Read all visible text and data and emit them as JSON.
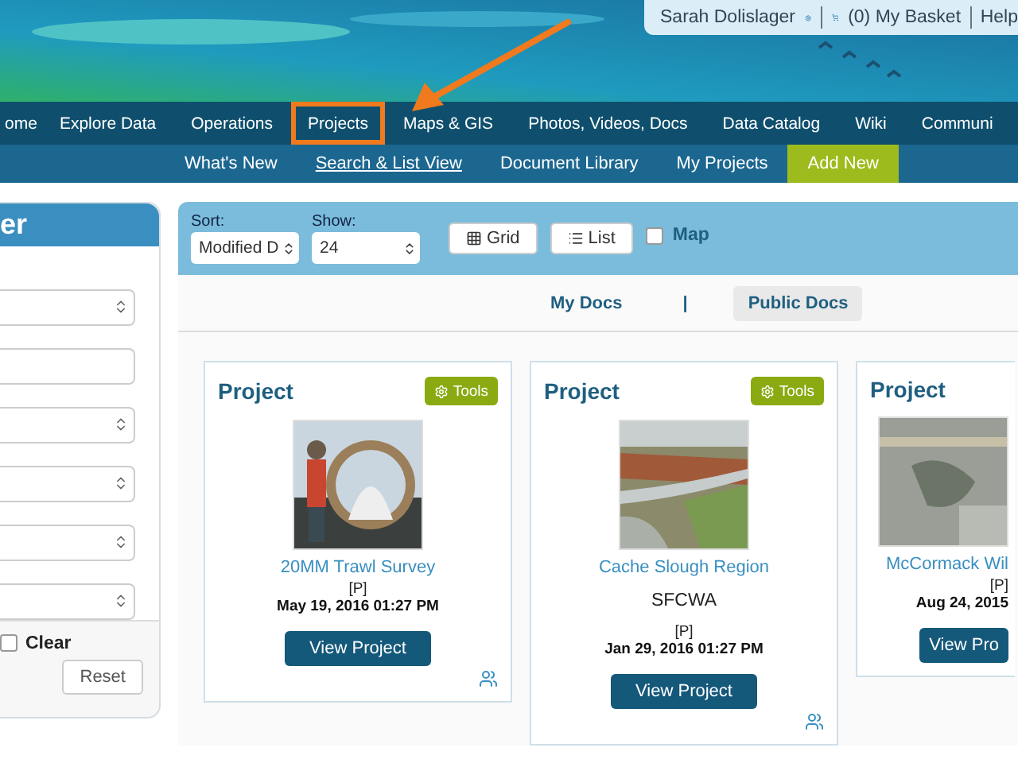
{
  "header": {
    "user": "Sarah Dolislager",
    "basket": "(0) My Basket",
    "help": "Help"
  },
  "main_nav": [
    {
      "label": "ome",
      "highlighted": false
    },
    {
      "label": "Explore Data",
      "highlighted": false
    },
    {
      "label": "Operations",
      "highlighted": false
    },
    {
      "label": "Projects",
      "highlighted": true
    },
    {
      "label": "Maps & GIS",
      "highlighted": false
    },
    {
      "label": "Photos, Videos, Docs",
      "highlighted": false
    },
    {
      "label": "Data Catalog",
      "highlighted": false
    },
    {
      "label": "Wiki",
      "highlighted": false
    },
    {
      "label": "Communi",
      "highlighted": false
    }
  ],
  "sub_nav": [
    {
      "label": "What's New",
      "kind": "link",
      "selected": false
    },
    {
      "label": "Search & List View",
      "kind": "link",
      "selected": true
    },
    {
      "label": "Document Library",
      "kind": "link",
      "selected": false
    },
    {
      "label": "My Projects",
      "kind": "link",
      "selected": false
    },
    {
      "label": "Add New",
      "kind": "action",
      "selected": false
    }
  ],
  "filter_panel": {
    "title": "er",
    "controls": [
      {
        "kind": "select"
      },
      {
        "kind": "input"
      },
      {
        "kind": "select"
      },
      {
        "kind": "select"
      },
      {
        "kind": "select"
      },
      {
        "kind": "select"
      }
    ],
    "clear": {
      "label": "Clear",
      "checked": false
    },
    "reset": "Reset"
  },
  "toolbar": {
    "sort": {
      "label": "Sort:",
      "value": "Modified D"
    },
    "show": {
      "label": "Show:",
      "value": "24"
    },
    "views": [
      {
        "label": "Grid",
        "kind": "grid"
      },
      {
        "label": "List",
        "kind": "list"
      }
    ],
    "map": {
      "label": "Map",
      "checked": false
    }
  },
  "doc_tabs": {
    "separator": "|",
    "tabs": [
      {
        "label": "My Docs",
        "selected": false
      },
      {
        "label": "Public Docs",
        "selected": true
      }
    ]
  },
  "cards": [
    {
      "heading": "Project",
      "tools": "Tools",
      "title": "20MM Trawl Survey",
      "flag": "[P]",
      "date": "May 19, 2016 01:27 PM",
      "button": "View Project",
      "partial": false
    },
    {
      "heading": "Project",
      "tools": "Tools",
      "title": "Cache Slough Region",
      "org": "SFCWA",
      "flag": "[P]",
      "date": "Jan 29, 2016 01:27 PM",
      "button": "View Project",
      "partial": false
    },
    {
      "heading": "Project",
      "title": "McCormack Wil",
      "flag": "[P]",
      "date": "Aug 24, 2015",
      "button": "View Pro",
      "partial": true
    }
  ]
}
